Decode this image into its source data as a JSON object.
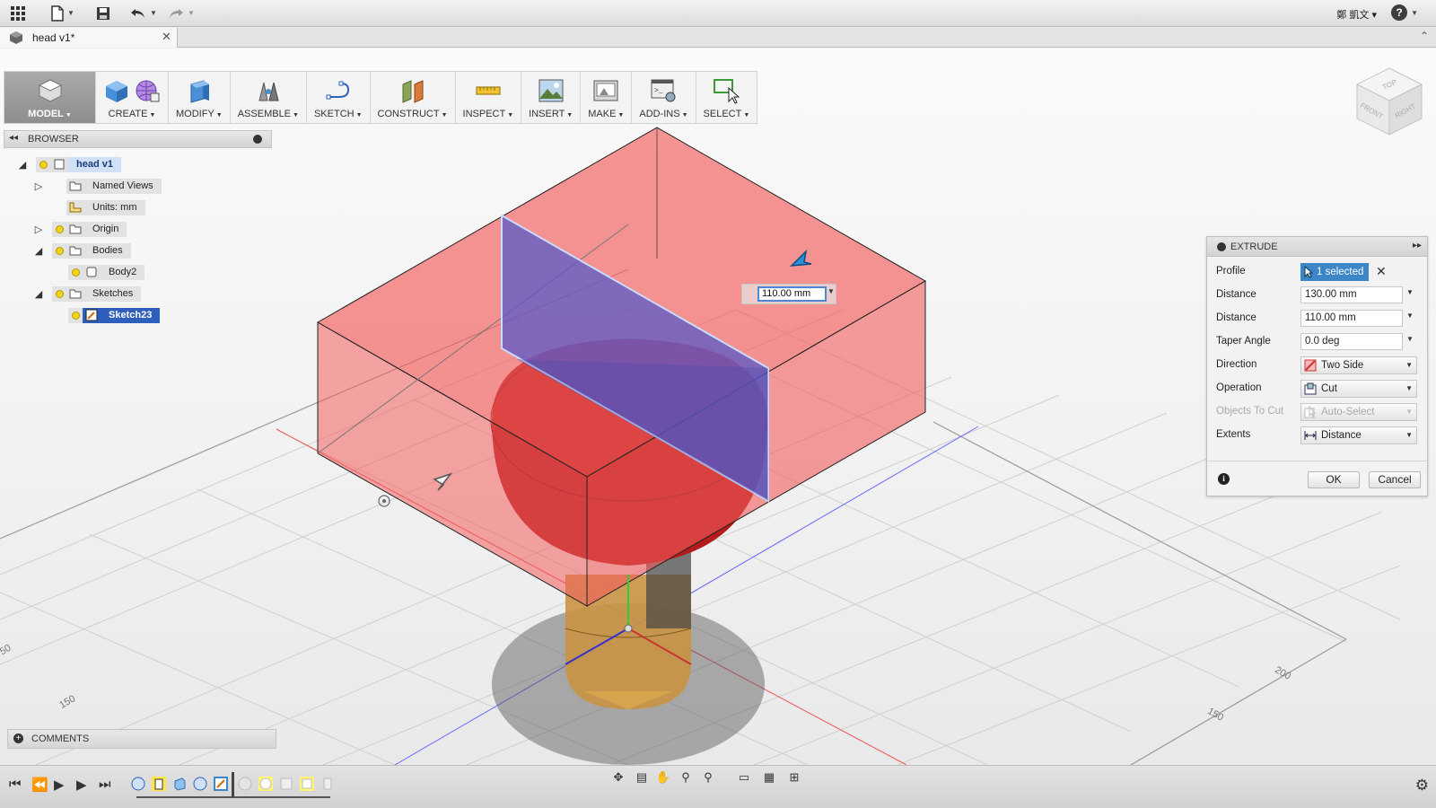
{
  "app": {
    "user_name": "鄭 凱文",
    "help_label": "?",
    "document_tab_title": "head v1*"
  },
  "toolbar": {
    "groups": [
      {
        "label": "MODEL",
        "icon": "model-workspace-icon"
      },
      {
        "label": "CREATE",
        "icon": "create-box-icon"
      },
      {
        "label": "MODIFY",
        "icon": "modify-icon"
      },
      {
        "label": "ASSEMBLE",
        "icon": "assemble-icon"
      },
      {
        "label": "SKETCH",
        "icon": "sketch-icon"
      },
      {
        "label": "CONSTRUCT",
        "icon": "construct-plane-icon"
      },
      {
        "label": "INSPECT",
        "icon": "inspect-measure-icon"
      },
      {
        "label": "INSERT",
        "icon": "insert-image-icon"
      },
      {
        "label": "MAKE",
        "icon": "make-3dprint-icon"
      },
      {
        "label": "ADD-INS",
        "icon": "addins-icon"
      },
      {
        "label": "SELECT",
        "icon": "select-icon"
      }
    ]
  },
  "browser": {
    "title": "BROWSER",
    "root": "head v1",
    "named_views": "Named Views",
    "units": "Units: mm",
    "origin": "Origin",
    "bodies": "Bodies",
    "body2": "Body2",
    "sketches": "Sketches",
    "sketch23": "Sketch23"
  },
  "comments": {
    "title": "COMMENTS"
  },
  "extrude": {
    "title": "EXTRUDE",
    "profile_label": "Profile",
    "profile_value": "1 selected",
    "distance1_label": "Distance",
    "distance1_value": "130.00 mm",
    "distance2_label": "Distance",
    "distance2_value": "110.00 mm",
    "taper_label": "Taper Angle",
    "taper_value": "0.0 deg",
    "direction_label": "Direction",
    "direction_value": "Two Side",
    "operation_label": "Operation",
    "operation_value": "Cut",
    "objects_label": "Objects To Cut",
    "objects_value": "Auto-Select",
    "extents_label": "Extents",
    "extents_value": "Distance",
    "ok_label": "OK",
    "cancel_label": "Cancel"
  },
  "viewport": {
    "dimension_input": "110.00 mm",
    "grid_labels": [
      "200",
      "150",
      "150",
      "50"
    ]
  },
  "viewcube": {
    "top": "TOP",
    "front": "FRONT",
    "right": "RIGHT"
  },
  "colors": {
    "cut_preview": "#f25c5c",
    "profile_plane": "#5a5ac8",
    "body_red": "#b31b1b",
    "selection_blue": "#3c86c7"
  }
}
